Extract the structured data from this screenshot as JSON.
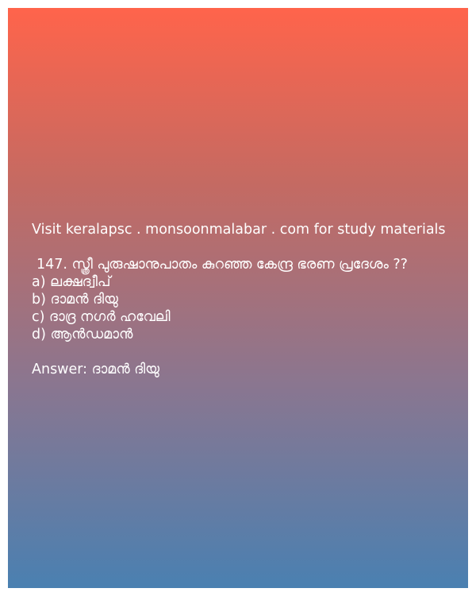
{
  "promo": {
    "text": "Visit keralapsc . monsoonmalabar . com for study materials"
  },
  "question": {
    "text": "147. സ്ത്രീ പുരുഷാനുപാതം കുറഞ്ഞ കേന്ദ്ര ഭരണ പ്രദേശം ??",
    "options": [
      "a) ലക്ഷദ്വീപ്",
      "b) ദാമൻ ദിയു",
      "c) ദാദ്ര നഗർ ഹവേലി",
      "d) ആൻഡമാൻ"
    ]
  },
  "answer": {
    "text": "Answer: ദാമൻ ദിയു"
  },
  "colors": {
    "gradient_top": "#ff644b",
    "gradient_bottom": "#4a80b1",
    "text": "#ffffff"
  }
}
